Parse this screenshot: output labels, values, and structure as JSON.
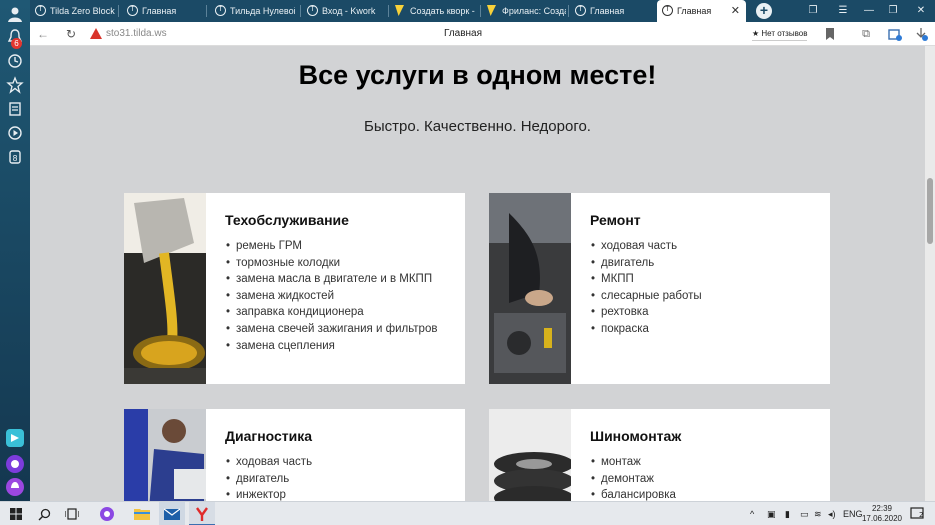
{
  "browser": {
    "tabs": [
      {
        "label": "Tilda Zero Block",
        "icon": "tilda-icon"
      },
      {
        "label": "Главная",
        "icon": "tilda-icon"
      },
      {
        "label": "Тильда Нулевой",
        "icon": "tilda-icon"
      },
      {
        "label": "Вход - Kwork",
        "icon": "tilda-icon"
      },
      {
        "label": "Создать кворк -",
        "icon": "kwork-icon"
      },
      {
        "label": "Фриланс: Создан",
        "icon": "kwork-icon"
      },
      {
        "label": "Главная",
        "icon": "tilda-icon"
      },
      {
        "label": "Главная",
        "icon": "tilda-icon",
        "active": true
      }
    ],
    "url": "sto31.tilda.ws",
    "page_title": "Главная",
    "reviews_label": "★ Нет отзывов",
    "sidebar_badge": "6",
    "extension_badge": "1"
  },
  "page": {
    "title": "Все услуги в одном месте!",
    "subtitle": "Быстро. Качественно. Недорого.",
    "services": [
      {
        "title": "Техобслуживание",
        "image": "oil-pour-photo",
        "items": [
          "ремень ГРМ",
          "тормозные колодки",
          "замена масла в двигателе и в МКПП",
          "замена жидкостей",
          "заправка кондиционера",
          "замена свечей зажигания и фильтров",
          "замена сцепления"
        ]
      },
      {
        "title": "Ремонт",
        "image": "engine-repair-photo",
        "items": [
          "ходовая часть",
          "двигатель",
          "МКПП",
          "слесарные работы",
          "рехтовка",
          "покраска"
        ]
      },
      {
        "title": "Диагностика",
        "image": "mechanic-hood-photo",
        "items": [
          "ходовая часть",
          "двигатель",
          "инжектор"
        ]
      },
      {
        "title": "Шиномонтаж",
        "image": "tires-photo",
        "items": [
          "монтаж",
          "демонтаж",
          "балансировка"
        ]
      }
    ]
  },
  "taskbar": {
    "language": "ENG",
    "time": "22:39",
    "date": "17.06.2020",
    "notification_count": "2"
  }
}
